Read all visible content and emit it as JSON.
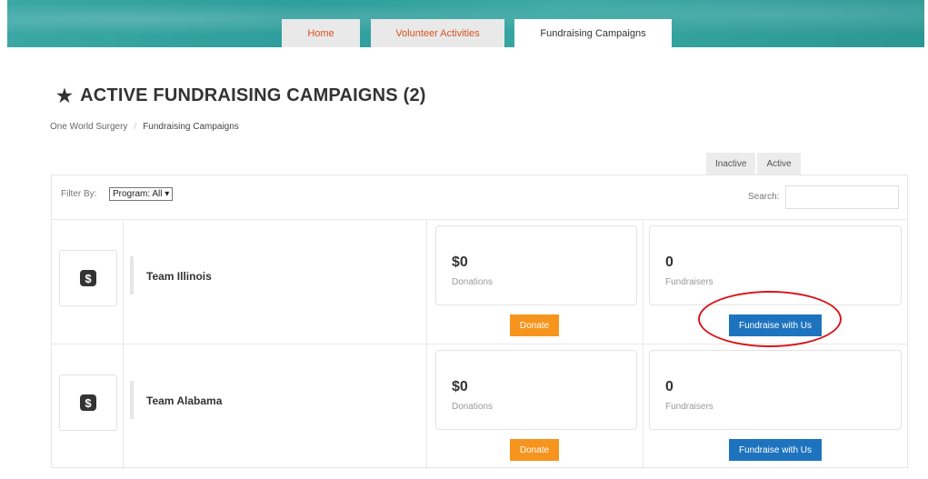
{
  "nav": {
    "tabs": [
      {
        "label": "Home"
      },
      {
        "label": "Volunteer Activities"
      },
      {
        "label": "Fundraising Campaigns"
      }
    ]
  },
  "page": {
    "title": "ACTIVE FUNDRAISING CAMPAIGNS (2)",
    "star_icon": "★"
  },
  "breadcrumb": {
    "root": "One World Surgery",
    "separator": "/",
    "current": "Fundraising Campaigns"
  },
  "status_tabs": [
    {
      "label": "Inactive"
    },
    {
      "label": "Active"
    }
  ],
  "filter": {
    "label": "Filter By:",
    "select_value": "Program: All ▾",
    "search_label": "Search:",
    "search_value": ""
  },
  "campaigns": [
    {
      "icon": "dollar-icon",
      "icon_glyph": "$",
      "name": "Team Illinois",
      "donations_value": "$0",
      "donations_label": "Donations",
      "fundraisers_value": "0",
      "fundraisers_label": "Fundraisers",
      "donate_label": "Donate",
      "fundraise_label": "Fundraise with Us"
    },
    {
      "icon": "dollar-icon",
      "icon_glyph": "$",
      "name": "Team Alabama",
      "donations_value": "$0",
      "donations_label": "Donations",
      "fundraisers_value": "0",
      "fundraisers_label": "Fundraisers",
      "donate_label": "Donate",
      "fundraise_label": "Fundraise with Us"
    }
  ],
  "colors": {
    "banner_teal": "#33a19e",
    "tab_link": "#d9531e",
    "donate_orange": "#f7941d",
    "fundraise_blue": "#1e73be",
    "highlight_red": "#d9141a"
  }
}
